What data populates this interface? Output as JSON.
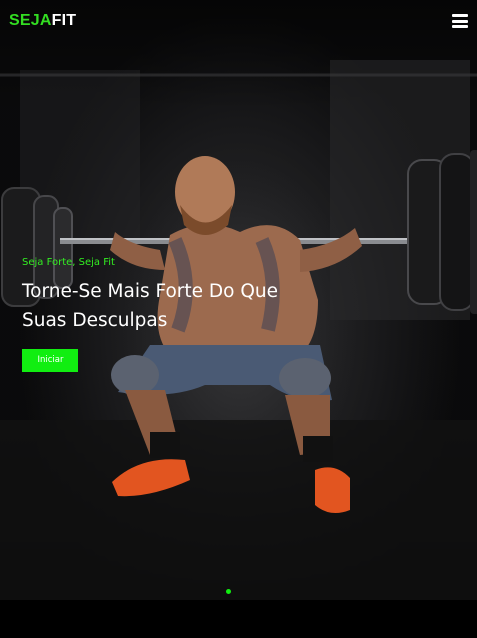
{
  "nav": {
    "logo_part1": "SEJA",
    "logo_part2": "FIT",
    "menu_icon": "hamburger-menu-icon"
  },
  "hero": {
    "kicker": "Seja Forte, Seja Fit",
    "headline": "Torne-Se Mais Forte Do Que Suas Desculpas",
    "cta_label": "Iniciar",
    "image": "weightlifter-barbell-squat-photo"
  },
  "slider": {
    "active_index": 1,
    "count": 1
  },
  "colors": {
    "accent": "#11ee11",
    "background": "#000000",
    "text": "#ffffff"
  }
}
